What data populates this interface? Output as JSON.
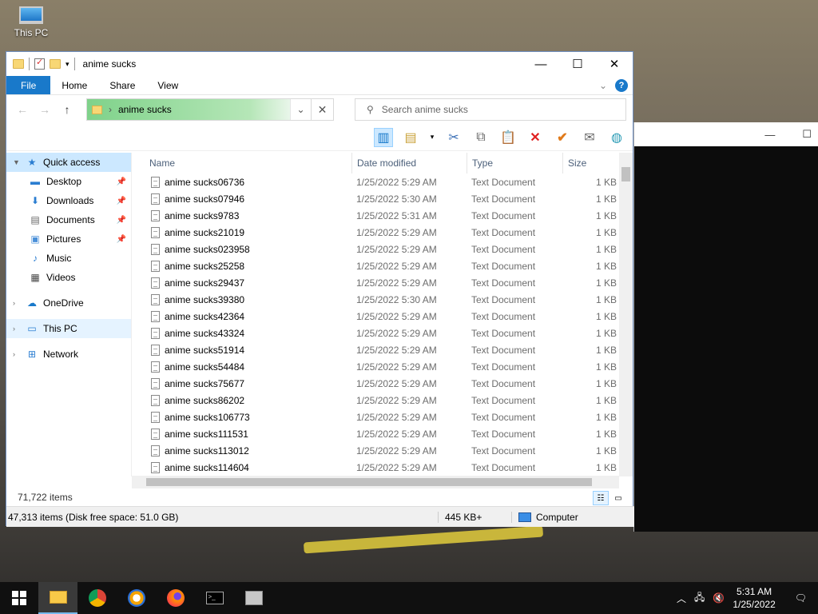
{
  "desktop": {
    "icon_label": "This PC"
  },
  "window": {
    "title": "anime sucks",
    "controls": {
      "min": "—",
      "max": "☐",
      "close": "✕"
    }
  },
  "ribbon": {
    "file": "File",
    "home": "Home",
    "share": "Share",
    "view": "View",
    "help": "?"
  },
  "address": {
    "path": "anime sucks",
    "sep": "›"
  },
  "search": {
    "placeholder": "Search anime sucks"
  },
  "nav": {
    "quick_access": "Quick access",
    "desktop": "Desktop",
    "downloads": "Downloads",
    "documents": "Documents",
    "pictures": "Pictures",
    "music": "Music",
    "videos": "Videos",
    "onedrive": "OneDrive",
    "this_pc": "This PC",
    "network": "Network"
  },
  "columns": {
    "name": "Name",
    "date": "Date modified",
    "type": "Type",
    "size": "Size"
  },
  "files": [
    {
      "name": "anime sucks06736",
      "date": "1/25/2022 5:29 AM",
      "type": "Text Document",
      "size": "1 KB"
    },
    {
      "name": "anime sucks07946",
      "date": "1/25/2022 5:30 AM",
      "type": "Text Document",
      "size": "1 KB"
    },
    {
      "name": "anime sucks9783",
      "date": "1/25/2022 5:31 AM",
      "type": "Text Document",
      "size": "1 KB"
    },
    {
      "name": "anime sucks21019",
      "date": "1/25/2022 5:29 AM",
      "type": "Text Document",
      "size": "1 KB"
    },
    {
      "name": "anime sucks023958",
      "date": "1/25/2022 5:29 AM",
      "type": "Text Document",
      "size": "1 KB"
    },
    {
      "name": "anime sucks25258",
      "date": "1/25/2022 5:29 AM",
      "type": "Text Document",
      "size": "1 KB"
    },
    {
      "name": "anime sucks29437",
      "date": "1/25/2022 5:29 AM",
      "type": "Text Document",
      "size": "1 KB"
    },
    {
      "name": "anime sucks39380",
      "date": "1/25/2022 5:30 AM",
      "type": "Text Document",
      "size": "1 KB"
    },
    {
      "name": "anime sucks42364",
      "date": "1/25/2022 5:29 AM",
      "type": "Text Document",
      "size": "1 KB"
    },
    {
      "name": "anime sucks43324",
      "date": "1/25/2022 5:29 AM",
      "type": "Text Document",
      "size": "1 KB"
    },
    {
      "name": "anime sucks51914",
      "date": "1/25/2022 5:29 AM",
      "type": "Text Document",
      "size": "1 KB"
    },
    {
      "name": "anime sucks54484",
      "date": "1/25/2022 5:29 AM",
      "type": "Text Document",
      "size": "1 KB"
    },
    {
      "name": "anime sucks75677",
      "date": "1/25/2022 5:29 AM",
      "type": "Text Document",
      "size": "1 KB"
    },
    {
      "name": "anime sucks86202",
      "date": "1/25/2022 5:29 AM",
      "type": "Text Document",
      "size": "1 KB"
    },
    {
      "name": "anime sucks106773",
      "date": "1/25/2022 5:29 AM",
      "type": "Text Document",
      "size": "1 KB"
    },
    {
      "name": "anime sucks111531",
      "date": "1/25/2022 5:29 AM",
      "type": "Text Document",
      "size": "1 KB"
    },
    {
      "name": "anime sucks113012",
      "date": "1/25/2022 5:29 AM",
      "type": "Text Document",
      "size": "1 KB"
    },
    {
      "name": "anime sucks114604",
      "date": "1/25/2022 5:29 AM",
      "type": "Text Document",
      "size": "1 KB"
    }
  ],
  "status": {
    "item_count": "71,722 items",
    "bar_items": "47,313 items (Disk free space: 51.0 GB)",
    "bar_size": "445 KB+",
    "bar_location": "Computer"
  },
  "taskbar": {
    "time": "5:31 AM",
    "date": "1/25/2022"
  },
  "colors": {
    "accent": "#1979ca",
    "selection": "#cce8ff"
  }
}
